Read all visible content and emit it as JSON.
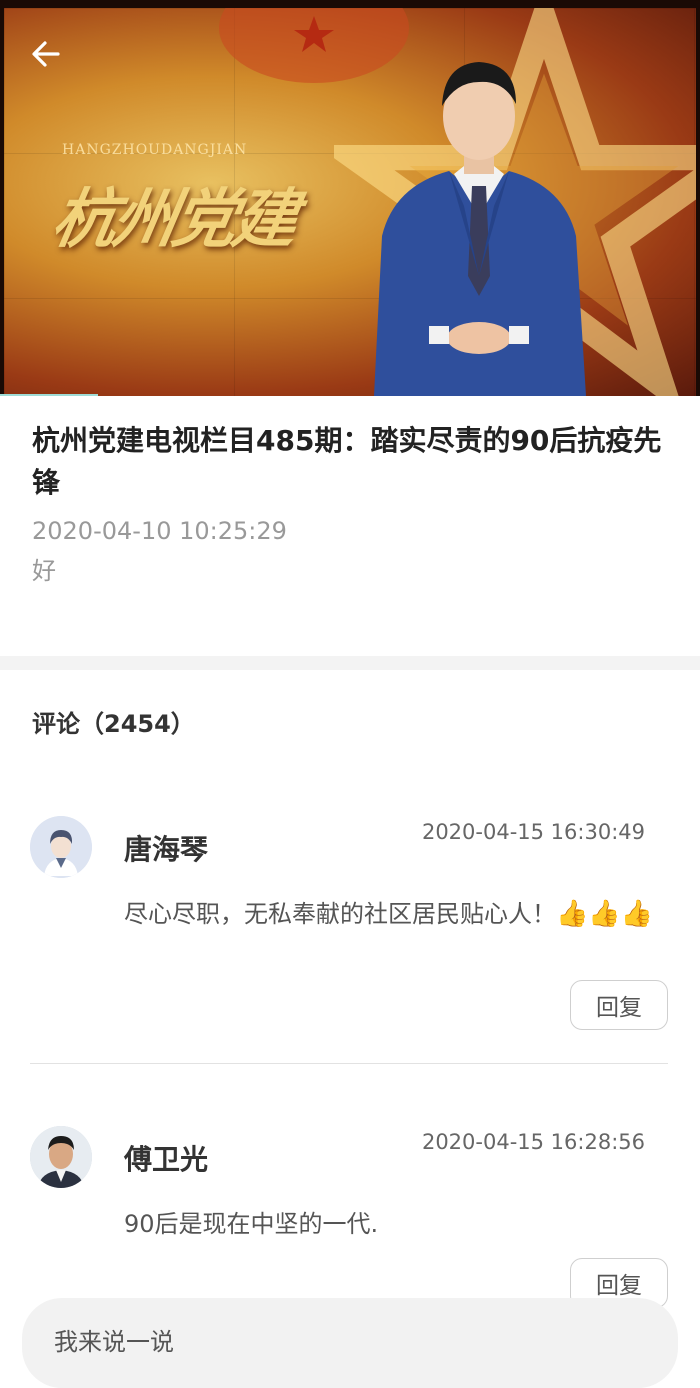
{
  "video": {
    "logo_small": "HANGZHOUDANGJIAN",
    "logo_big": "杭州党建"
  },
  "article": {
    "title": "杭州党建电视栏目485期：踏实尽责的90后抗疫先锋",
    "date": "2020-04-10 10:25:29",
    "summary": "好"
  },
  "comments": {
    "heading": "评论（2454）",
    "items": [
      {
        "name": "唐海琴",
        "time": "2020-04-15 16:30:49",
        "text": "尽心尽职，无私奉献的社区居民贴心人！",
        "emoji": "👍👍👍",
        "reply_label": "回复"
      },
      {
        "name": "傅卫光",
        "time": "2020-04-15 16:28:56",
        "text": "90后是现在中坚的一代.",
        "reply_label": "回复"
      }
    ]
  },
  "bottom_bar": {
    "placeholder": "我来说一说"
  },
  "colors": {
    "accent": "#9fdcd6",
    "text_dark": "#222222",
    "text_muted": "#999999"
  }
}
